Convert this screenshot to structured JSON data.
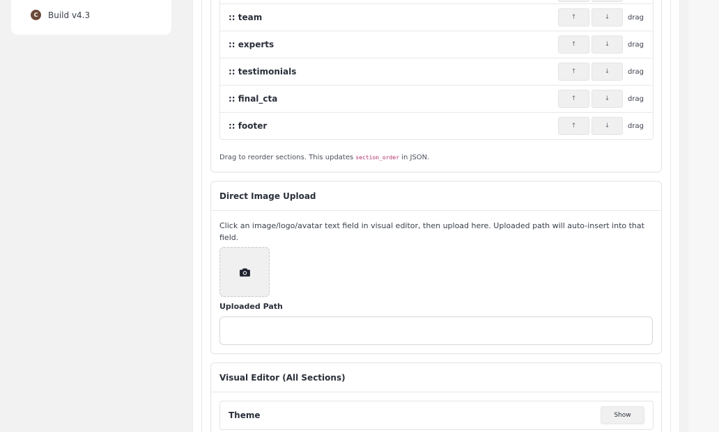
{
  "sidebar": {
    "build_badge": "C",
    "build_label": "Build v4.3"
  },
  "section_order": {
    "rows": [
      {
        "label": "",
        "up": "↑",
        "down": "↓",
        "drag": ""
      },
      {
        "label": ":: team",
        "up": "↑",
        "down": "↓",
        "drag": "drag"
      },
      {
        "label": ":: experts",
        "up": "↑",
        "down": "↓",
        "drag": "drag"
      },
      {
        "label": ":: testimonials",
        "up": "↑",
        "down": "↓",
        "drag": "drag"
      },
      {
        "label": ":: final_cta",
        "up": "↑",
        "down": "↓",
        "drag": "drag"
      },
      {
        "label": ":: footer",
        "up": "↑",
        "down": "↓",
        "drag": "drag"
      }
    ],
    "note_prefix": "Drag to reorder sections. This updates ",
    "note_code": "section_order",
    "note_suffix": " in JSON."
  },
  "image_upload": {
    "title": "Direct Image Upload",
    "help": "Click an image/logo/avatar text field in visual editor, then upload here. Uploaded path will auto-insert into that field.",
    "drop_icon": "camera-icon",
    "path_label": "Uploaded Path",
    "path_value": ""
  },
  "visual_editor": {
    "title": "Visual Editor (All Sections)",
    "theme_title": "Theme",
    "show_label": "Show"
  },
  "colors": {
    "accent_avatar": "#6b4a3a",
    "code_text": "#b0306a"
  }
}
